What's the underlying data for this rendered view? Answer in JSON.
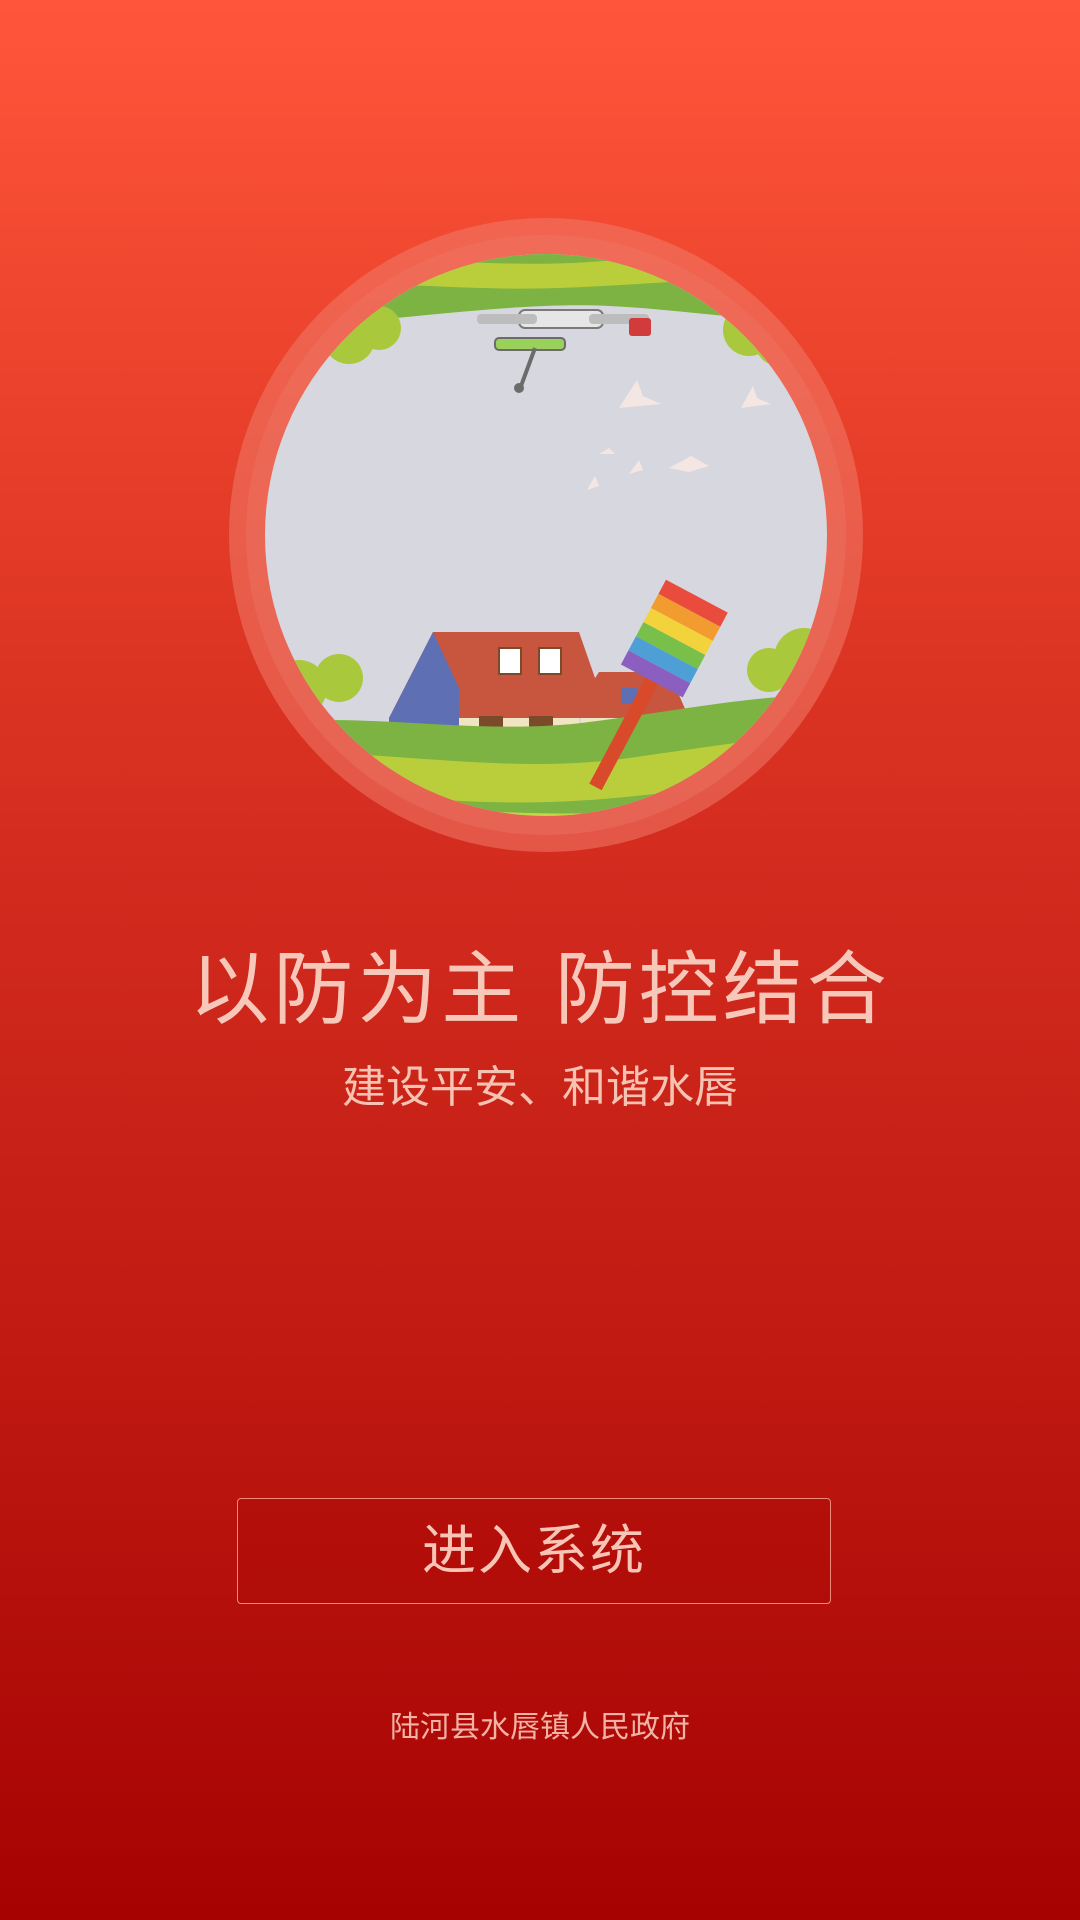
{
  "hero": {
    "icon": "village-scene-illustration"
  },
  "slogan": {
    "main": "以防为主  防控结合",
    "sub": "建设平安、和谐水唇"
  },
  "enter_button": {
    "label": "进入系统"
  },
  "footer": {
    "organization": "陆河县水唇镇人民政府"
  },
  "colors": {
    "background_top": "#ff563b",
    "background_bottom": "#a60202",
    "text": "#f7c8b9",
    "button_border": "#f08a78"
  }
}
